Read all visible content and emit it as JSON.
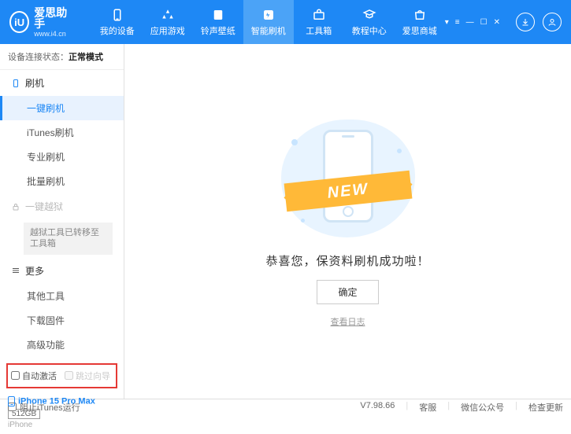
{
  "logo": {
    "mark": "iU",
    "title": "爱思助手",
    "sub": "www.i4.cn"
  },
  "nav": {
    "items": [
      {
        "icon": "device",
        "label": "我的设备"
      },
      {
        "icon": "apps",
        "label": "应用游戏"
      },
      {
        "icon": "rings",
        "label": "铃声壁纸"
      },
      {
        "icon": "flash",
        "label": "智能刷机"
      },
      {
        "icon": "toolbox",
        "label": "工具箱"
      },
      {
        "icon": "tutorial",
        "label": "教程中心"
      },
      {
        "icon": "store",
        "label": "爱思商城"
      }
    ],
    "active_index": 3
  },
  "win": {
    "menu": "▾",
    "list": "≡",
    "min": "—",
    "max": "☐",
    "close": "✕"
  },
  "topright": {
    "download": "↓",
    "user": "◯"
  },
  "sidebar": {
    "status_label": "设备连接状态：",
    "status_value": "正常模式",
    "sec_flash": "刷机",
    "items_flash": [
      "一键刷机",
      "iTunes刷机",
      "专业刷机",
      "批量刷机"
    ],
    "sec_jail": "一键越狱",
    "jail_note": "越狱工具已转移至工具箱",
    "sec_more": "更多",
    "items_more": [
      "其他工具",
      "下载固件",
      "高级功能"
    ],
    "chk_auto": "自动激活",
    "chk_skip": "跳过向导"
  },
  "device": {
    "name": "iPhone 15 Pro Max",
    "storage": "512GB",
    "type": "iPhone"
  },
  "main": {
    "banner": "NEW",
    "message": "恭喜您，保资料刷机成功啦！",
    "ok": "确定",
    "log": "查看日志"
  },
  "footer": {
    "block_itunes": "阻止iTunes运行",
    "version": "V7.98.66",
    "links": [
      "客服",
      "微信公众号",
      "检查更新"
    ]
  }
}
